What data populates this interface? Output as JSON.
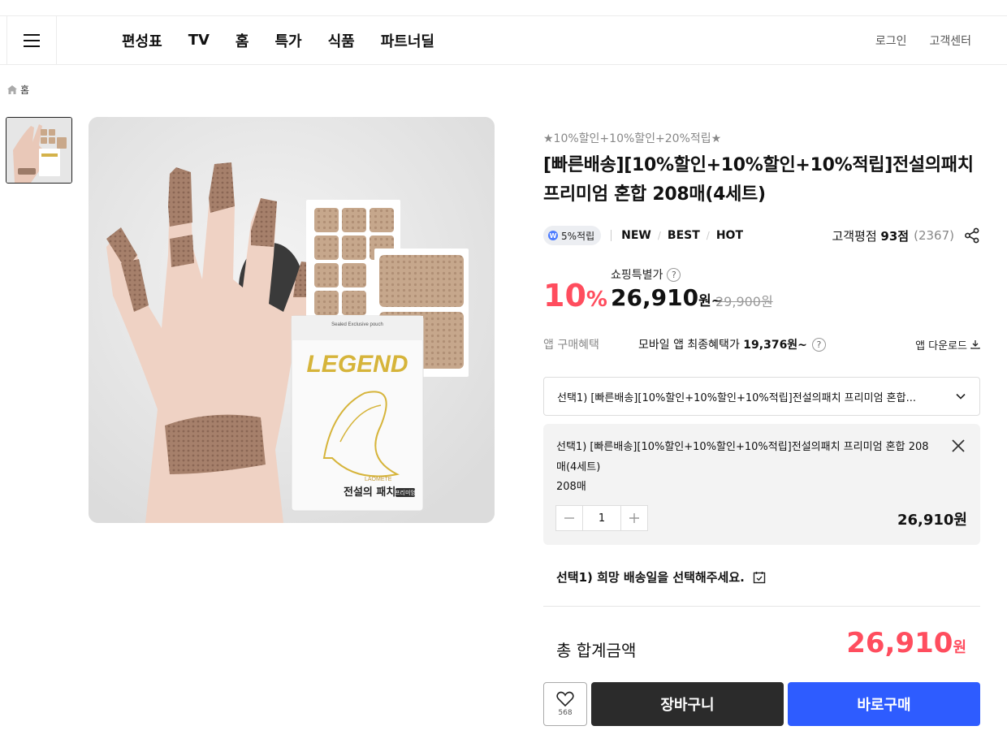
{
  "nav": {
    "items": [
      "편성표",
      "TV",
      "홈",
      "특가",
      "식품",
      "파트너딜"
    ],
    "login": "로그인",
    "customer_center": "고객센터"
  },
  "breadcrumb": {
    "home": "홈"
  },
  "product": {
    "promo": "★10%할인+10%할인+20%적립★",
    "title": "[빠른배송][10%할인+10%할인+10%적립]전설의패치 프리미엄 혼합 208매(4세트)",
    "point_badge": "5%적립",
    "tags": [
      "NEW",
      "BEST",
      "HOT"
    ],
    "rating_label": "고객평점",
    "rating_value": "93점",
    "rating_count": "(2367)",
    "price_label": "쇼핑특별가",
    "discount_num": "10",
    "discount_unit": "%",
    "price_num": "26,910",
    "price_unit": "원~",
    "original_price": "29,900원",
    "app_label": "앱 구매혜택",
    "app_text": "모바일 앱 최종혜택가",
    "app_price": "19,376원~",
    "app_download": "앱 다운로드"
  },
  "image_labels": {
    "pouch_brand": "LEGEND",
    "pouch_caption": "Sealed Exclusive pouch",
    "pouch_logo": "LAOMETE",
    "pouch_name": "전설의 패치",
    "pouch_sub": "프리미엄"
  },
  "option": {
    "select_text": "선택1) [빠른배송][10%할인+10%할인+10%적립]전설의패치 프리미엄 혼합...",
    "selected_name": "선택1) [빠른배송][10%할인+10%할인+10%적립]전설의패치 프리미엄 혼합 208매(4세트)",
    "selected_qty_label": "208매",
    "quantity": "1",
    "selected_price": "26,910원"
  },
  "delivery": {
    "text": "선택1) 희망 배송일을 선택해주세요."
  },
  "total": {
    "label": "총 합계금액",
    "amount": "26,910",
    "unit": "원"
  },
  "actions": {
    "like_count": "568",
    "cart": "장바구니",
    "buy": "바로구매"
  },
  "colors": {
    "accent_red": "#ff4d5e",
    "buy_blue": "#2e5cff",
    "cart_dark": "#2b2b2b"
  }
}
